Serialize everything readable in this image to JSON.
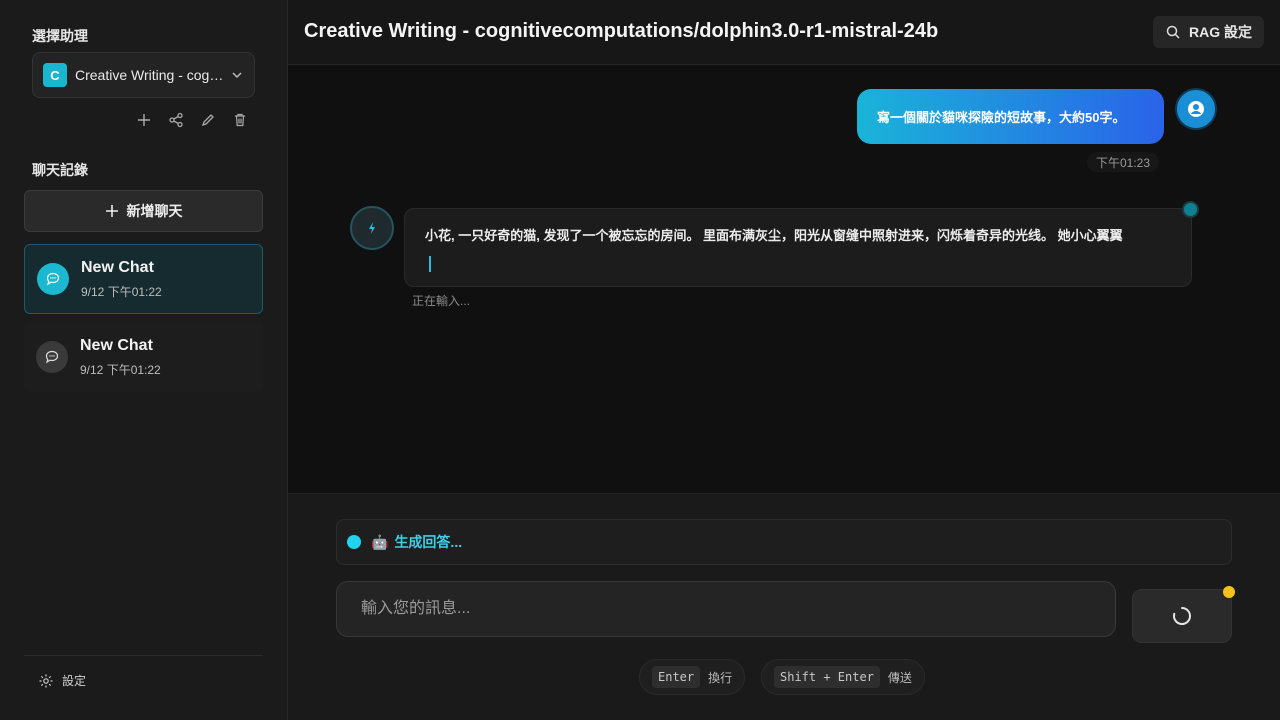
{
  "sidebar": {
    "assistant_section_title": "選擇助理",
    "assistant": {
      "avatar_letter": "C",
      "name": "Creative Writing - cognitivecomputations/dolphin3.0-r1-mistral-24b"
    },
    "history_section_title": "聊天記錄",
    "new_chat_label": "新增聊天",
    "chats": [
      {
        "title": "New Chat",
        "time": "9/12 下午01:22",
        "active": true
      },
      {
        "title": "New Chat",
        "time": "9/12 下午01:22",
        "active": false
      }
    ],
    "settings_label": "設定"
  },
  "header": {
    "title": "Creative Writing - cognitivecomputations/dolphin3.0-r1-mistral-24b",
    "rag_button_label": "RAG 設定"
  },
  "messages": {
    "user": {
      "text": "寫一個關於貓咪探險的短故事，大約50字。",
      "time": "下午01:23"
    },
    "assistant": {
      "text": "小花, 一只好奇的猫, 发现了一个被忘忘的房间。 里面布满灰尘，阳光从窗缝中照射进来，闪烁着奇异的光线。 她小心翼翼",
      "status": "正在輸入..."
    }
  },
  "composer": {
    "status_text": "生成回答...",
    "status_emoji": "🤖",
    "input_placeholder": "輸入您的訊息...",
    "input_value": "",
    "hints": [
      {
        "key": "Enter",
        "label": "換行"
      },
      {
        "key": "Shift + Enter",
        "label": "傳送"
      }
    ]
  },
  "colors": {
    "accent": "#22d3ee",
    "bubble_start": "#1ab4d8",
    "bubble_end": "#2a63e9",
    "notif": "#f6c21a"
  }
}
